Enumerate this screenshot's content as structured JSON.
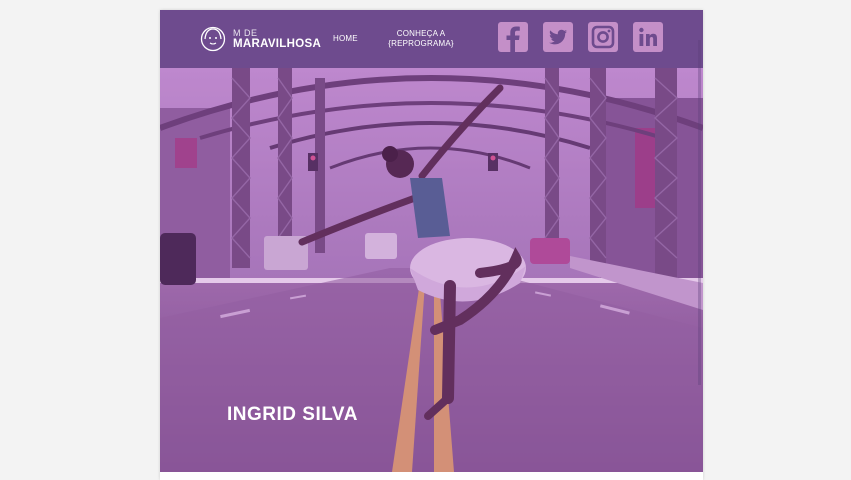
{
  "header": {
    "logo_small": "M DE",
    "logo_big": "MARAVILHOSA",
    "nav": {
      "home": "HOME",
      "reprograma_line1": "CONHEÇA A",
      "reprograma_line2": "{REPROGRAMA}"
    },
    "social": [
      "facebook-icon",
      "twitter-icon",
      "instagram-icon",
      "linkedin-icon"
    ]
  },
  "hero": {
    "title": "INGRID SILVA"
  },
  "colors": {
    "header_bg": "#6e4b8e",
    "overlay": "#a03cb4",
    "social_bg": "#c48fc8"
  }
}
